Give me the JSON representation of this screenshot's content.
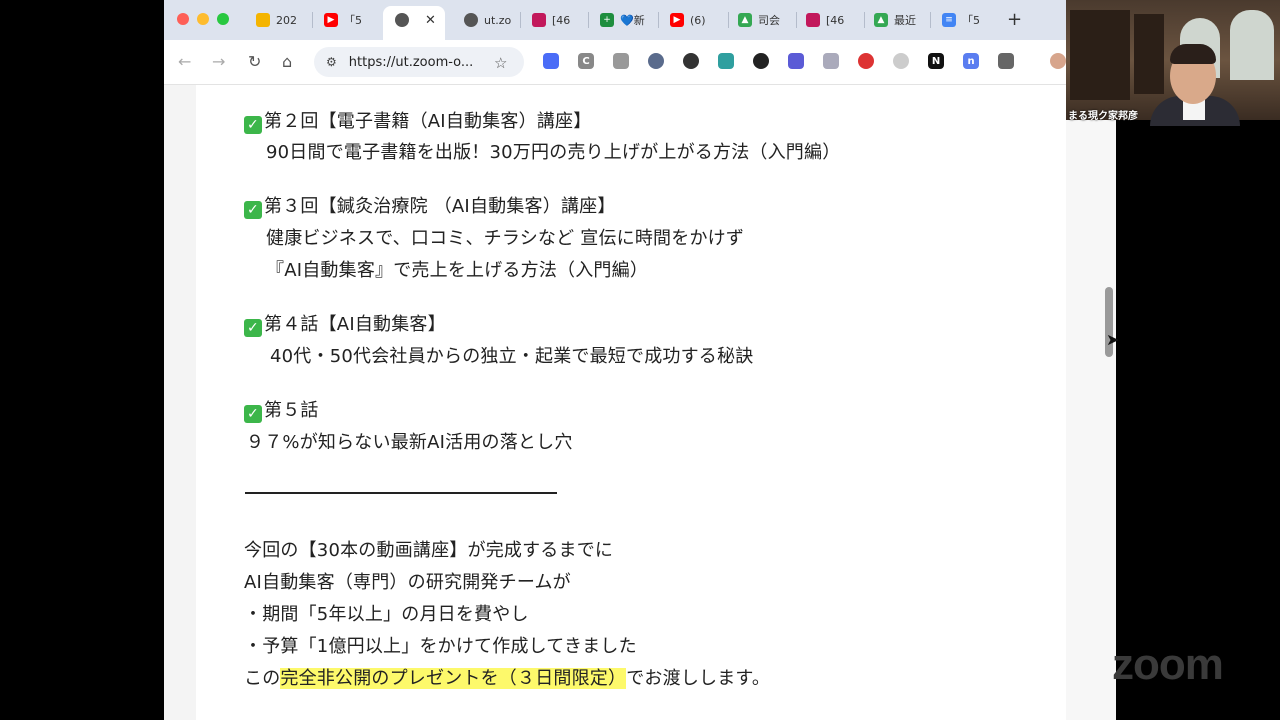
{
  "browser": {
    "tabs": [
      {
        "label": "202",
        "icon": "google-slides-icon",
        "color": "#f4b400"
      },
      {
        "label": "「5",
        "icon": "youtube-icon",
        "color": "#ff0000"
      },
      {
        "label": "",
        "icon": "globe-icon",
        "color": "#555555",
        "active": true
      },
      {
        "label": "ut.zo",
        "icon": "globe-icon",
        "color": "#555555"
      },
      {
        "label": "[46",
        "icon": "app-icon",
        "color": "#c2185b"
      },
      {
        "label": "💙新",
        "icon": "plus-icon",
        "color": "#1e8e3e"
      },
      {
        "label": "(6)",
        "icon": "youtube-icon",
        "color": "#ff0000"
      },
      {
        "label": "司会",
        "icon": "google-drive-icon",
        "color": "#34a853"
      },
      {
        "label": "[46",
        "icon": "app-icon",
        "color": "#c2185b"
      },
      {
        "label": "最近",
        "icon": "google-drive-icon",
        "color": "#34a853"
      },
      {
        "label": "「5",
        "icon": "google-docs-icon",
        "color": "#4285f4"
      }
    ],
    "close_tab": "✕",
    "new_tab": "+",
    "url": "https://ut.zoom-o...",
    "extensions": [
      "C",
      "N",
      "n"
    ]
  },
  "content": {
    "item2_title": "第２回【電子書籍（AI自動集客）講座】",
    "item2_desc": "90日間で電子書籍を出版！30万円の売り上げが上がる方法（入門編）",
    "item3_title": "第３回【鍼灸治療院 （AI自動集客）講座】",
    "item3_desc1": "健康ビジネスで、口コミ、チラシなど 宣伝に時間をかけず",
    "item3_desc2": "『AI自動集客』で売上を上げる方法（入門編）",
    "item4_title": "第４話【AI自動集客】",
    "item4_desc": "40代・50代会社員からの独立・起業で最短で成功する秘訣",
    "item5_title": "第５話",
    "item5_desc": "９７%が知らない最新AI活用の落とし穴",
    "para1": "今回の【30本の動画講座】が完成するまでに",
    "para2": "AI自動集客（専門）の研究開発チームが",
    "para3": "・期間「5年以上」の月日を費やし",
    "para4": "・予算「1億円以上」をかけて作成してきました",
    "para5_prefix": "この",
    "para5_highlight": "完全非公開のプレゼントを（３日間限定）",
    "para5_suffix": "でお渡しします。"
  },
  "video": {
    "participant_name": "まる現ク家邦彦"
  },
  "zoom_brand": "zoom"
}
